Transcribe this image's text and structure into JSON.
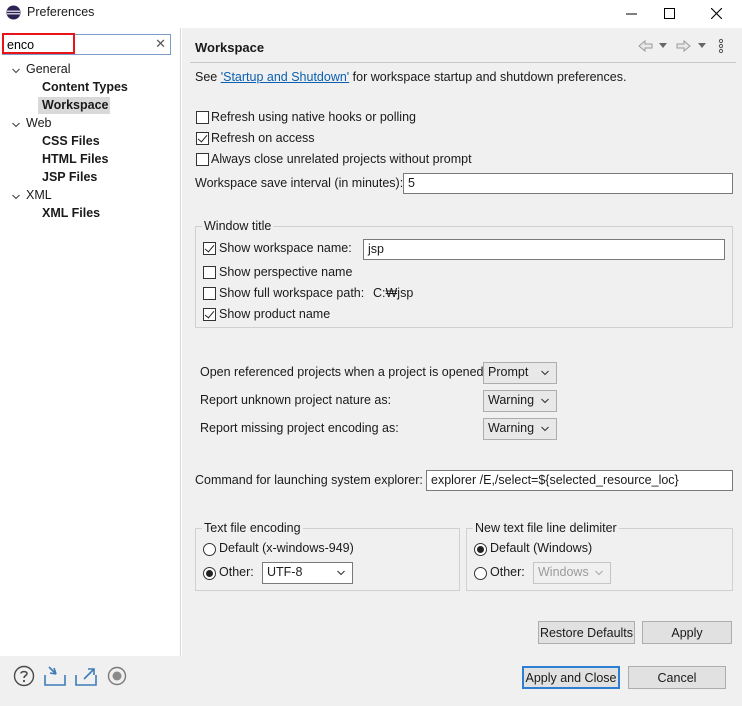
{
  "window": {
    "title": "Preferences",
    "minimize_glyph": "—",
    "maximize_glyph": "☐",
    "close_glyph": "✕"
  },
  "filter": {
    "value": "enco",
    "clear_glyph": "✕"
  },
  "tree": [
    {
      "label": "General",
      "children": [
        "Content Types",
        "Workspace"
      ]
    },
    {
      "label": "Web",
      "children": [
        "CSS Files",
        "HTML Files",
        "JSP Files"
      ]
    },
    {
      "label": "XML",
      "children": [
        "XML Files"
      ]
    }
  ],
  "tree_selected": "Workspace",
  "page": {
    "title": "Workspace",
    "intro_prefix": "See ",
    "intro_link": "'Startup and Shutdown'",
    "intro_suffix": " for workspace startup and shutdown preferences."
  },
  "options": {
    "refresh_native": {
      "label": "Refresh using native hooks or polling",
      "checked": false
    },
    "refresh_access": {
      "label": "Refresh on access",
      "checked": true
    },
    "always_close": {
      "label": "Always close unrelated projects without prompt",
      "checked": false
    },
    "save_interval_label": "Workspace save interval (in minutes):",
    "save_interval_value": "5"
  },
  "window_title_group": {
    "title": "Window title",
    "show_workspace_name": {
      "label": "Show workspace name:",
      "checked": true,
      "value": "jsp"
    },
    "show_perspective_name": {
      "label": "Show perspective name",
      "checked": false
    },
    "show_full_path": {
      "label": "Show full workspace path:",
      "checked": false,
      "value": "C:₩jsp"
    },
    "show_product_name": {
      "label": "Show product name",
      "checked": true
    }
  },
  "projects": {
    "open_referenced_label": "Open referenced projects when a project is opened:",
    "open_referenced_value": "Prompt",
    "unknown_nature_label": "Report unknown project nature as:",
    "unknown_nature_value": "Warning",
    "missing_encoding_label": "Report missing project encoding as:",
    "missing_encoding_value": "Warning"
  },
  "explorer": {
    "label": "Command for launching system explorer:",
    "value": "explorer /E,/select=${selected_resource_loc}"
  },
  "encoding_group": {
    "title": "Text file encoding",
    "default_label": "Default (x-windows-949)",
    "other_label": "Other:",
    "other_value": "UTF-8",
    "selected": "other"
  },
  "delimiter_group": {
    "title": "New text file line delimiter",
    "default_label": "Default (Windows)",
    "other_label": "Other:",
    "other_value": "Windows",
    "selected": "default"
  },
  "buttons": {
    "restore_defaults": "Restore Defaults",
    "apply": "Apply",
    "apply_and_close": "Apply and Close",
    "cancel": "Cancel"
  },
  "colors": {
    "accent": "#2d7fd4",
    "link": "#0b5fb1",
    "highlight_box": "#e8141a",
    "pane_bg": "#f0f0f0"
  },
  "icons": [
    "eclipse-icon",
    "back-icon",
    "forward-icon",
    "view-menu-icon",
    "help-icon",
    "import-icon",
    "export-icon",
    "oomph-icon"
  ]
}
